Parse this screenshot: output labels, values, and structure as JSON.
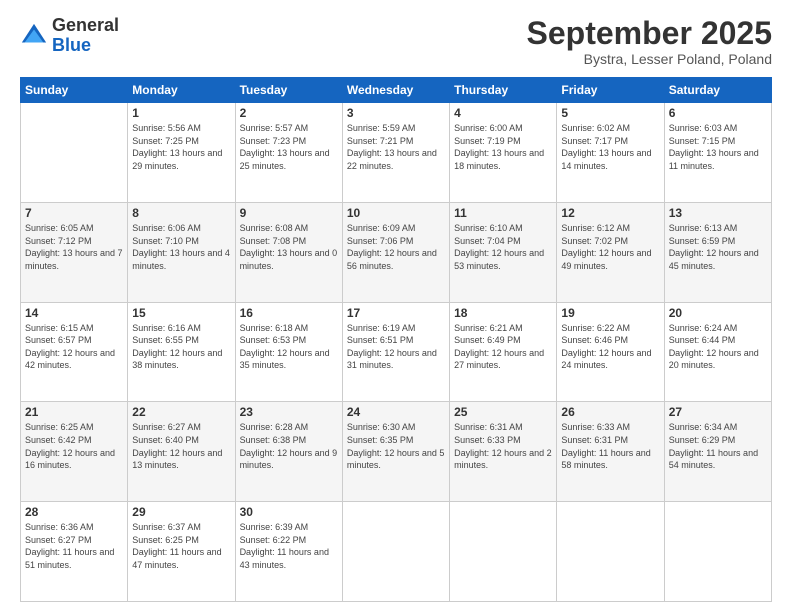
{
  "logo": {
    "general": "General",
    "blue": "Blue"
  },
  "header": {
    "month": "September 2025",
    "location": "Bystra, Lesser Poland, Poland"
  },
  "days_of_week": [
    "Sunday",
    "Monday",
    "Tuesday",
    "Wednesday",
    "Thursday",
    "Friday",
    "Saturday"
  ],
  "weeks": [
    [
      {
        "day": "",
        "sunrise": "",
        "sunset": "",
        "daylight": ""
      },
      {
        "day": "1",
        "sunrise": "Sunrise: 5:56 AM",
        "sunset": "Sunset: 7:25 PM",
        "daylight": "Daylight: 13 hours and 29 minutes."
      },
      {
        "day": "2",
        "sunrise": "Sunrise: 5:57 AM",
        "sunset": "Sunset: 7:23 PM",
        "daylight": "Daylight: 13 hours and 25 minutes."
      },
      {
        "day": "3",
        "sunrise": "Sunrise: 5:59 AM",
        "sunset": "Sunset: 7:21 PM",
        "daylight": "Daylight: 13 hours and 22 minutes."
      },
      {
        "day": "4",
        "sunrise": "Sunrise: 6:00 AM",
        "sunset": "Sunset: 7:19 PM",
        "daylight": "Daylight: 13 hours and 18 minutes."
      },
      {
        "day": "5",
        "sunrise": "Sunrise: 6:02 AM",
        "sunset": "Sunset: 7:17 PM",
        "daylight": "Daylight: 13 hours and 14 minutes."
      },
      {
        "day": "6",
        "sunrise": "Sunrise: 6:03 AM",
        "sunset": "Sunset: 7:15 PM",
        "daylight": "Daylight: 13 hours and 11 minutes."
      }
    ],
    [
      {
        "day": "7",
        "sunrise": "Sunrise: 6:05 AM",
        "sunset": "Sunset: 7:12 PM",
        "daylight": "Daylight: 13 hours and 7 minutes."
      },
      {
        "day": "8",
        "sunrise": "Sunrise: 6:06 AM",
        "sunset": "Sunset: 7:10 PM",
        "daylight": "Daylight: 13 hours and 4 minutes."
      },
      {
        "day": "9",
        "sunrise": "Sunrise: 6:08 AM",
        "sunset": "Sunset: 7:08 PM",
        "daylight": "Daylight: 13 hours and 0 minutes."
      },
      {
        "day": "10",
        "sunrise": "Sunrise: 6:09 AM",
        "sunset": "Sunset: 7:06 PM",
        "daylight": "Daylight: 12 hours and 56 minutes."
      },
      {
        "day": "11",
        "sunrise": "Sunrise: 6:10 AM",
        "sunset": "Sunset: 7:04 PM",
        "daylight": "Daylight: 12 hours and 53 minutes."
      },
      {
        "day": "12",
        "sunrise": "Sunrise: 6:12 AM",
        "sunset": "Sunset: 7:02 PM",
        "daylight": "Daylight: 12 hours and 49 minutes."
      },
      {
        "day": "13",
        "sunrise": "Sunrise: 6:13 AM",
        "sunset": "Sunset: 6:59 PM",
        "daylight": "Daylight: 12 hours and 45 minutes."
      }
    ],
    [
      {
        "day": "14",
        "sunrise": "Sunrise: 6:15 AM",
        "sunset": "Sunset: 6:57 PM",
        "daylight": "Daylight: 12 hours and 42 minutes."
      },
      {
        "day": "15",
        "sunrise": "Sunrise: 6:16 AM",
        "sunset": "Sunset: 6:55 PM",
        "daylight": "Daylight: 12 hours and 38 minutes."
      },
      {
        "day": "16",
        "sunrise": "Sunrise: 6:18 AM",
        "sunset": "Sunset: 6:53 PM",
        "daylight": "Daylight: 12 hours and 35 minutes."
      },
      {
        "day": "17",
        "sunrise": "Sunrise: 6:19 AM",
        "sunset": "Sunset: 6:51 PM",
        "daylight": "Daylight: 12 hours and 31 minutes."
      },
      {
        "day": "18",
        "sunrise": "Sunrise: 6:21 AM",
        "sunset": "Sunset: 6:49 PM",
        "daylight": "Daylight: 12 hours and 27 minutes."
      },
      {
        "day": "19",
        "sunrise": "Sunrise: 6:22 AM",
        "sunset": "Sunset: 6:46 PM",
        "daylight": "Daylight: 12 hours and 24 minutes."
      },
      {
        "day": "20",
        "sunrise": "Sunrise: 6:24 AM",
        "sunset": "Sunset: 6:44 PM",
        "daylight": "Daylight: 12 hours and 20 minutes."
      }
    ],
    [
      {
        "day": "21",
        "sunrise": "Sunrise: 6:25 AM",
        "sunset": "Sunset: 6:42 PM",
        "daylight": "Daylight: 12 hours and 16 minutes."
      },
      {
        "day": "22",
        "sunrise": "Sunrise: 6:27 AM",
        "sunset": "Sunset: 6:40 PM",
        "daylight": "Daylight: 12 hours and 13 minutes."
      },
      {
        "day": "23",
        "sunrise": "Sunrise: 6:28 AM",
        "sunset": "Sunset: 6:38 PM",
        "daylight": "Daylight: 12 hours and 9 minutes."
      },
      {
        "day": "24",
        "sunrise": "Sunrise: 6:30 AM",
        "sunset": "Sunset: 6:35 PM",
        "daylight": "Daylight: 12 hours and 5 minutes."
      },
      {
        "day": "25",
        "sunrise": "Sunrise: 6:31 AM",
        "sunset": "Sunset: 6:33 PM",
        "daylight": "Daylight: 12 hours and 2 minutes."
      },
      {
        "day": "26",
        "sunrise": "Sunrise: 6:33 AM",
        "sunset": "Sunset: 6:31 PM",
        "daylight": "Daylight: 11 hours and 58 minutes."
      },
      {
        "day": "27",
        "sunrise": "Sunrise: 6:34 AM",
        "sunset": "Sunset: 6:29 PM",
        "daylight": "Daylight: 11 hours and 54 minutes."
      }
    ],
    [
      {
        "day": "28",
        "sunrise": "Sunrise: 6:36 AM",
        "sunset": "Sunset: 6:27 PM",
        "daylight": "Daylight: 11 hours and 51 minutes."
      },
      {
        "day": "29",
        "sunrise": "Sunrise: 6:37 AM",
        "sunset": "Sunset: 6:25 PM",
        "daylight": "Daylight: 11 hours and 47 minutes."
      },
      {
        "day": "30",
        "sunrise": "Sunrise: 6:39 AM",
        "sunset": "Sunset: 6:22 PM",
        "daylight": "Daylight: 11 hours and 43 minutes."
      },
      {
        "day": "",
        "sunrise": "",
        "sunset": "",
        "daylight": ""
      },
      {
        "day": "",
        "sunrise": "",
        "sunset": "",
        "daylight": ""
      },
      {
        "day": "",
        "sunrise": "",
        "sunset": "",
        "daylight": ""
      },
      {
        "day": "",
        "sunrise": "",
        "sunset": "",
        "daylight": ""
      }
    ]
  ]
}
